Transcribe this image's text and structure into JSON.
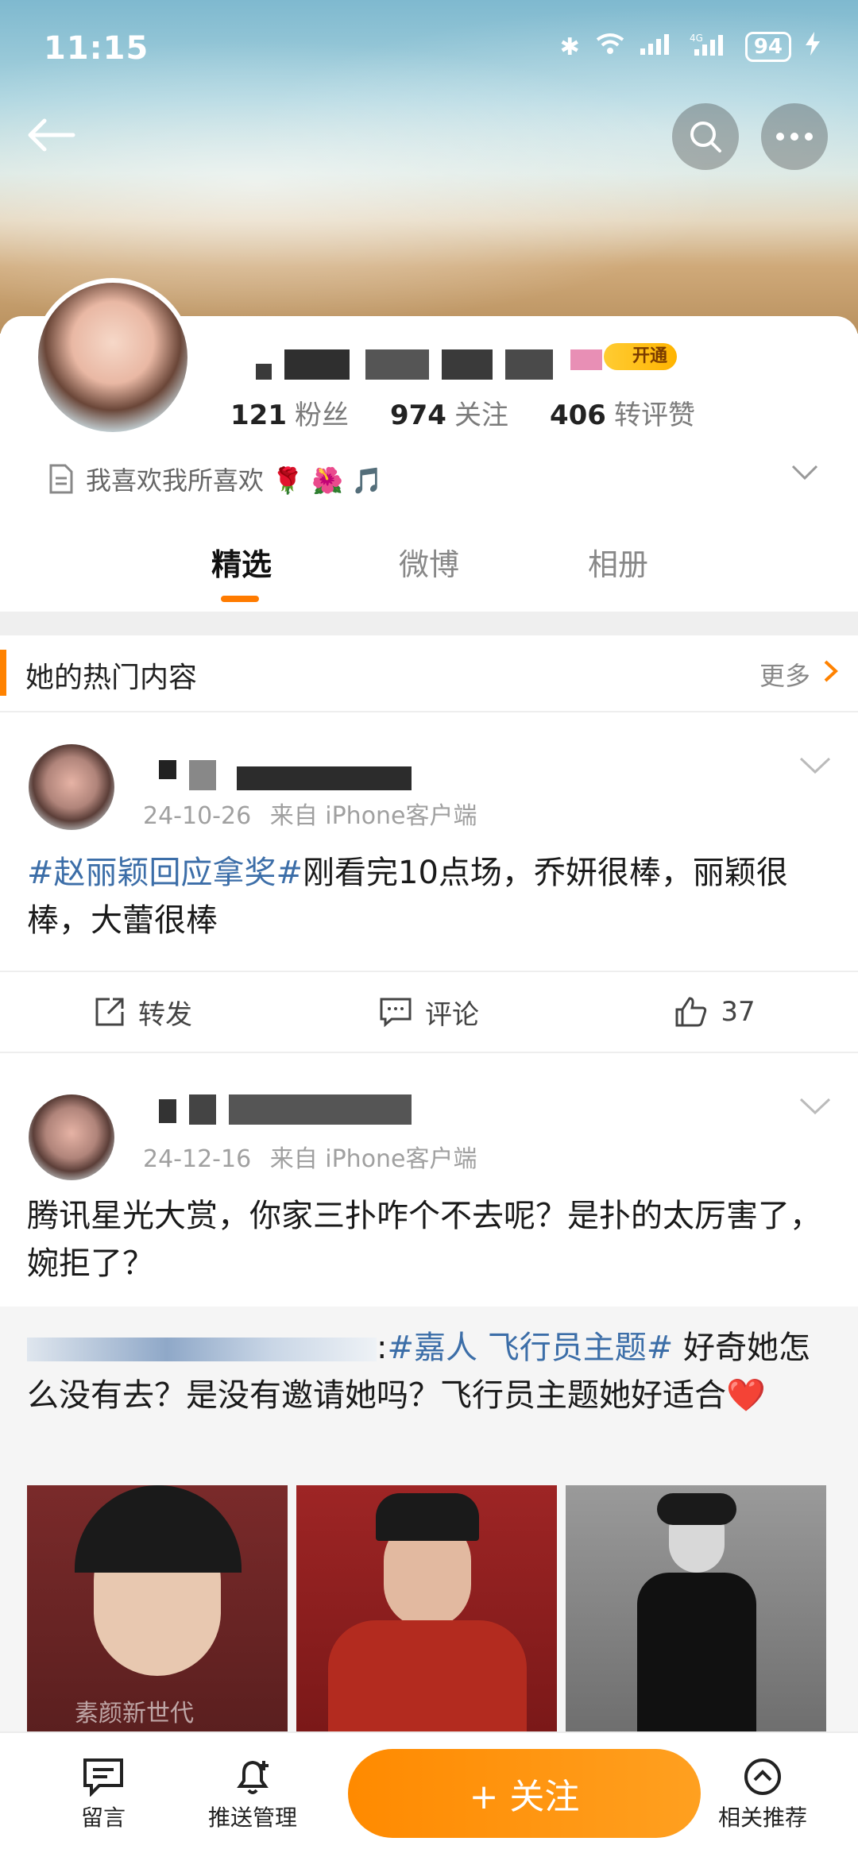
{
  "status_bar": {
    "time": "11:15",
    "battery": "94"
  },
  "profile": {
    "vip_badge": "开通",
    "stats": [
      {
        "value": "121",
        "label": "粉丝"
      },
      {
        "value": "974",
        "label": "关注"
      },
      {
        "value": "406",
        "label": "转评赞"
      }
    ],
    "bio": "我喜欢我所喜欢 🌹 🌺 🎵"
  },
  "tabs": [
    "精选",
    "微博",
    "相册"
  ],
  "section": {
    "title": "她的热门内容",
    "more": "更多"
  },
  "posts": [
    {
      "date": "24-10-26",
      "source": "来自 iPhone客户端",
      "tag": "#赵丽颖回应拿奖#",
      "text": "刚看完10点场，乔妍很棒，丽颖很棒，大蕾很棒",
      "actions": {
        "repost": "转发",
        "comment": "评论",
        "like": "37"
      }
    },
    {
      "date": "24-12-16",
      "source": "来自 iPhone客户端",
      "text": "腾讯星光大赏，你家三扑咋个不去呢？是扑的太厉害了，婉拒了？",
      "repost": {
        "prefix": ":",
        "tag": "#嘉人 飞行员主题#",
        "text": " 好奇她怎么没有去？是没有邀请她吗？飞行员主题她好适合❤️",
        "thumb_caption": "素颜新世代"
      }
    }
  ],
  "bottom_bar": {
    "message": "留言",
    "push": "推送管理",
    "follow": "+ 关注",
    "recommend": "相关推荐"
  }
}
